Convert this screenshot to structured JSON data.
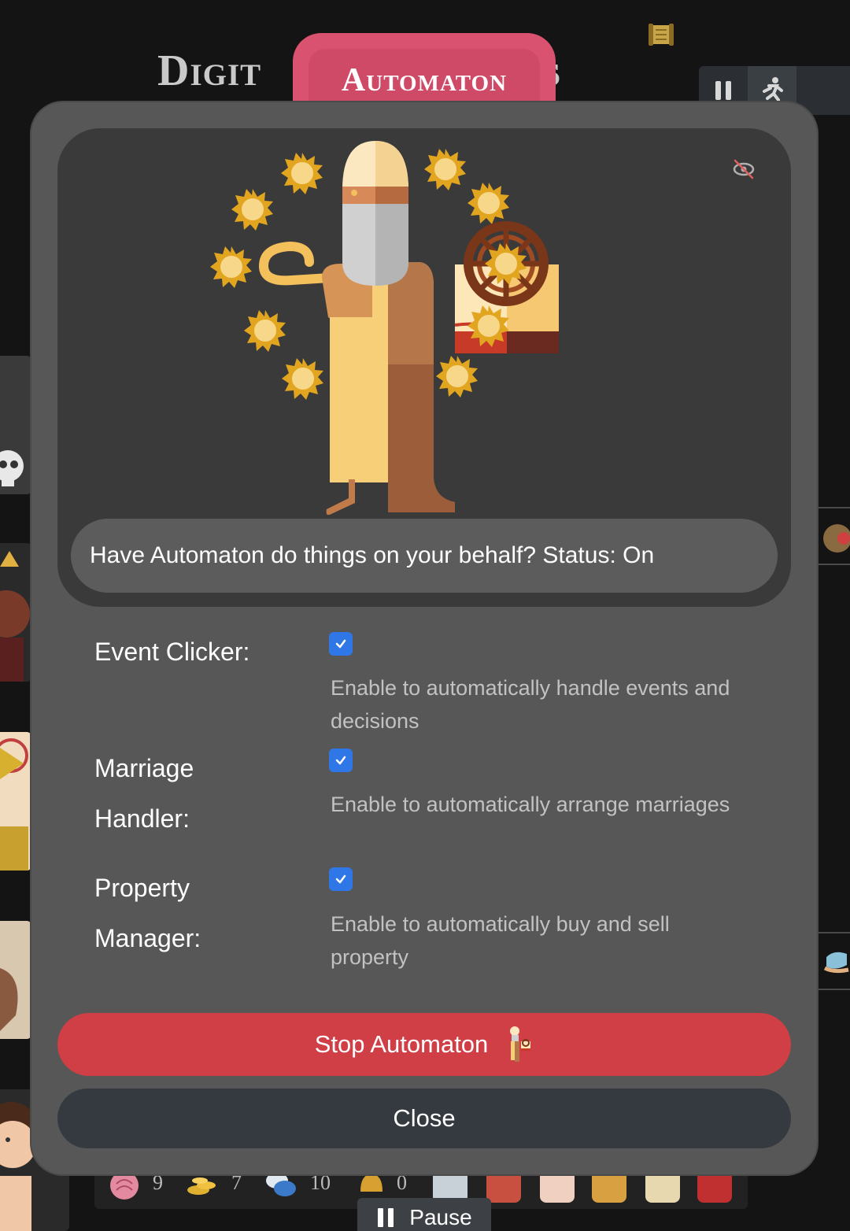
{
  "background": {
    "title_left": "Digit",
    "title_right": "s",
    "stats": [
      {
        "icon": "brain-icon",
        "value": "9"
      },
      {
        "icon": "coins-icon",
        "value": "7"
      },
      {
        "icon": "chat-icon",
        "value": "10"
      },
      {
        "icon": "helmet-icon",
        "value": "0"
      }
    ],
    "pause_label": "Pause"
  },
  "tab": {
    "label": "Automaton"
  },
  "modal": {
    "status_text": "Have Automaton do things on your behalf? Status: On",
    "options": [
      {
        "label": "Event Clicker:",
        "checked": true,
        "description": "Enable to automatically handle events and decisions"
      },
      {
        "label": "Marriage Handler:",
        "checked": true,
        "description": "Enable to automatically arrange marriages"
      },
      {
        "label": "Property Manager:",
        "checked": true,
        "description": "Enable to automatically buy and sell property"
      }
    ],
    "stop_button": "Stop Automaton",
    "close_button": "Close"
  },
  "colors": {
    "tab": "#d9526f",
    "modal": "#575757",
    "hero": "#3a3a3a",
    "stop": "#cf3f45",
    "close": "#343a40",
    "checkbox": "#2f76e6"
  }
}
